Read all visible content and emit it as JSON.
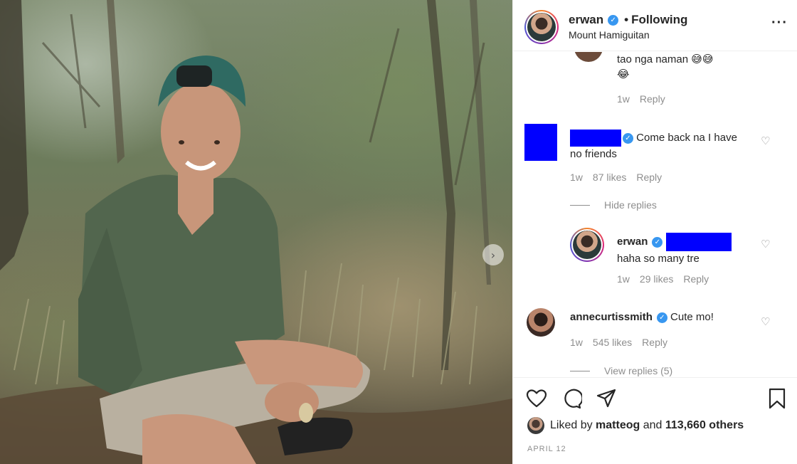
{
  "post": {
    "username": "erwan",
    "verified_icon": "verified-badge-icon",
    "separator": "•",
    "follow_status": "Following",
    "location": "Mount Hamiguitan",
    "more_icon": "more-options-icon",
    "next_icon": "chevron-right-icon"
  },
  "comments": {
    "top_partial": {
      "text": "tao nga naman 😅😅",
      "text2": "😂",
      "time": "1w",
      "reply": "Reply"
    },
    "c1": {
      "username": "",
      "text_line1": "Come back na I have",
      "text_line2": "no friends",
      "time": "1w",
      "likes": "87 likes",
      "reply": "Reply",
      "hide_replies": "Hide replies"
    },
    "r1": {
      "username": "erwan",
      "text": "haha so many tre",
      "time": "1w",
      "likes": "29 likes",
      "reply": "Reply"
    },
    "c2": {
      "username": "annecurtissmith",
      "text": "Cute mo!",
      "time": "1w",
      "likes": "545 likes",
      "reply": "Reply",
      "view_replies": "View replies (5)"
    }
  },
  "actions": {
    "like_icon": "heart-icon",
    "comment_icon": "comment-icon",
    "share_icon": "share-icon",
    "save_icon": "bookmark-icon"
  },
  "liked_by": {
    "prefix": "Liked by",
    "user": "matteog",
    "and": "and",
    "others": "113,660 others"
  },
  "date": "APRIL 12",
  "colors": {
    "verified": "#3897f0",
    "redaction": "#0000ff",
    "muted": "#8e8e8e"
  }
}
